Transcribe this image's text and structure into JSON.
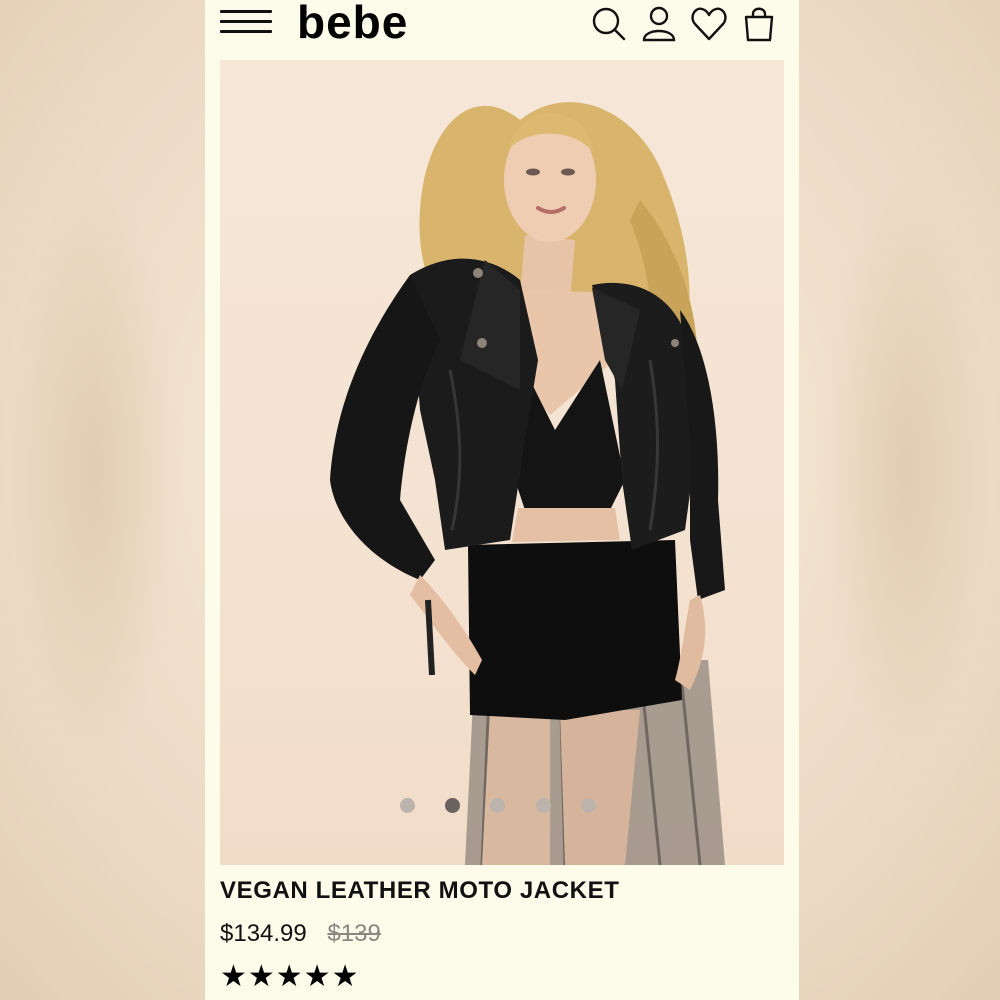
{
  "header": {
    "logo_text": "bebe",
    "menu_icon": "hamburger-menu-icon",
    "search_icon": "search-icon",
    "account_icon": "user-icon",
    "wishlist_icon": "heart-icon",
    "bag_icon": "shopping-bag-icon"
  },
  "gallery": {
    "image_count": 5,
    "active_index": 1
  },
  "product": {
    "name": "VEGAN LEATHER MOTO JACKET",
    "sale_price": "$134.99",
    "original_price": "$139",
    "rating_stars": "★★★★★",
    "rating": 5
  },
  "colors": {
    "page_background": "#fdfbea",
    "text": "#111111",
    "strike_price": "#8c8580"
  }
}
